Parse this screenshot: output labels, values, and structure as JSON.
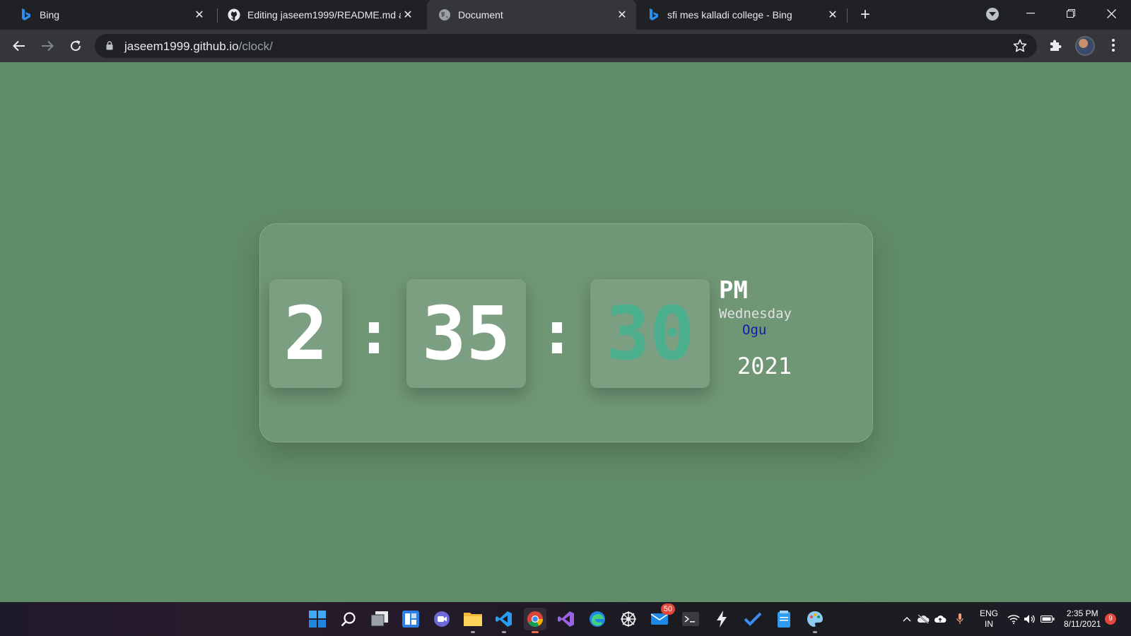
{
  "browser": {
    "tabs": [
      {
        "title": "Bing",
        "favicon": "bing-icon",
        "active": false
      },
      {
        "title": "Editing jaseem1999/README.md at",
        "favicon": "github-icon",
        "active": false
      },
      {
        "title": "Document",
        "favicon": "globe-icon",
        "active": true
      },
      {
        "title": "sfi mes kalladi college - Bing",
        "favicon": "bing-icon",
        "active": false
      }
    ],
    "address": {
      "host": "jaseem1999.github.io",
      "path": "/clock/"
    },
    "colors": {
      "tab_bar": "#202124",
      "toolbar": "#35363a",
      "omnibox": "#202124",
      "text": "#e8eaed"
    }
  },
  "clock": {
    "hours": "2",
    "colon": ":",
    "minutes": "35",
    "seconds": "30",
    "ampm": "PM",
    "day": "Wednesday",
    "month": "Ogu",
    "year": "2021",
    "colors": {
      "page_bg": "#618c68",
      "seconds": "#4caf8e",
      "month": "#0b1fa8",
      "day": "#e1e1e1"
    }
  },
  "taskbar": {
    "apps": [
      {
        "name": "start-icon"
      },
      {
        "name": "search-icon"
      },
      {
        "name": "task-view-icon"
      },
      {
        "name": "widgets-icon"
      },
      {
        "name": "chat-icon"
      },
      {
        "name": "file-explorer-icon"
      },
      {
        "name": "vscode-icon"
      },
      {
        "name": "chrome-icon",
        "active": true
      },
      {
        "name": "visual-studio-icon"
      },
      {
        "name": "edge-icon"
      },
      {
        "name": "settings-icon"
      },
      {
        "name": "mail-icon",
        "badge": "50"
      },
      {
        "name": "terminal-icon"
      },
      {
        "name": "lightning-icon"
      },
      {
        "name": "todo-icon"
      },
      {
        "name": "notepad-icon"
      },
      {
        "name": "paint-icon"
      }
    ],
    "tray": {
      "lang_top": "ENG",
      "lang_bottom": "IN",
      "time": "2:35 PM",
      "date": "8/11/2021",
      "notifications": "9"
    }
  }
}
